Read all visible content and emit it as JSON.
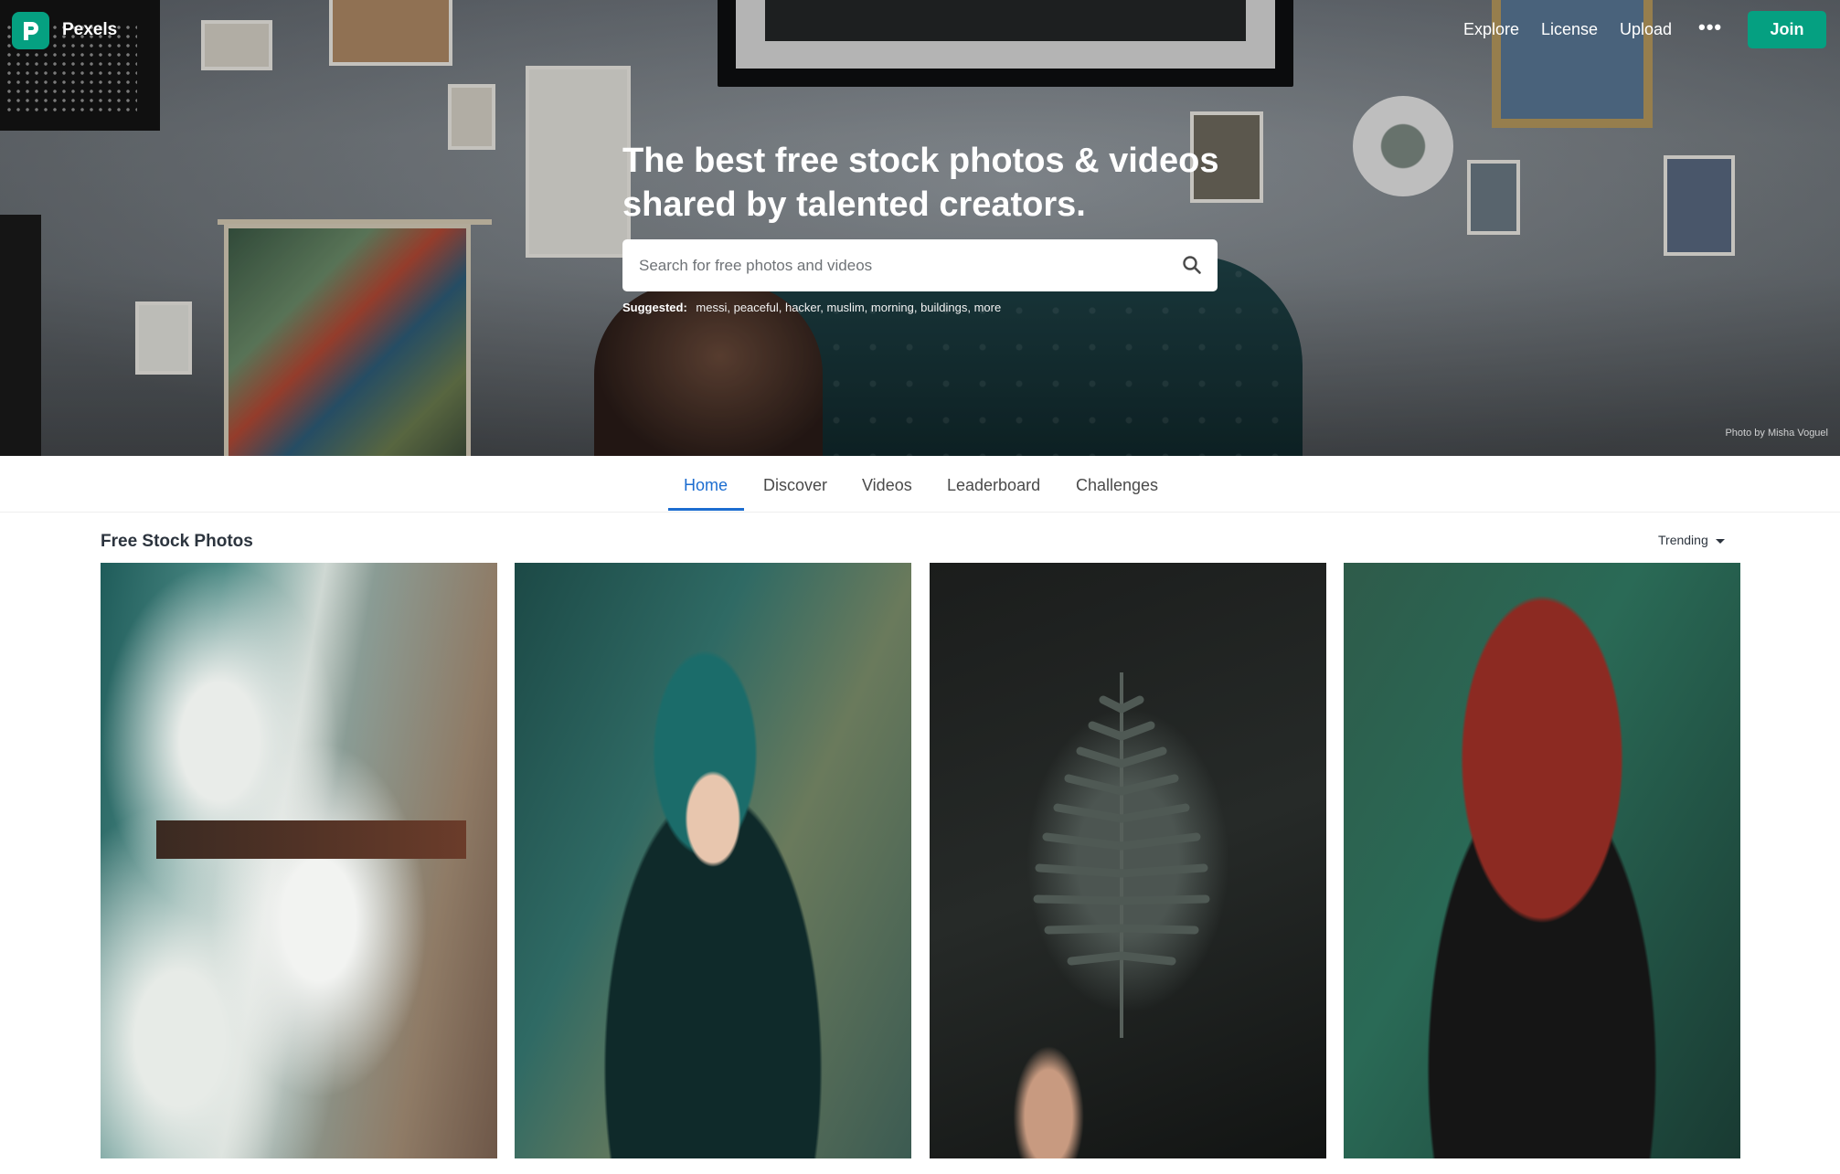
{
  "brand": {
    "name": "Pexels",
    "logo_icon": "pexels-p-logo-icon",
    "accent": "#05a081"
  },
  "nav": {
    "links": [
      {
        "label": "Explore"
      },
      {
        "label": "License"
      },
      {
        "label": "Upload"
      }
    ],
    "more_icon": "more-dots-icon",
    "more_label": "•••",
    "join_label": "Join"
  },
  "hero": {
    "headline": "The best free stock photos & videos shared by talented creators.",
    "search_placeholder": "Search for free photos and videos",
    "search_icon": "search-icon",
    "suggested_label": "Suggested:",
    "suggested_terms": "messi, peaceful, hacker, muslim, morning, buildings, more",
    "credit": "Photo by Misha Voguel"
  },
  "tabs": [
    {
      "label": "Home",
      "active": true
    },
    {
      "label": "Discover"
    },
    {
      "label": "Videos"
    },
    {
      "label": "Leaderboard"
    },
    {
      "label": "Challenges"
    }
  ],
  "tab_active_color": "#1c6dd0",
  "content": {
    "section_title": "Free Stock Photos",
    "sort_label": "Trending",
    "sort_icon": "caret-down-icon"
  }
}
